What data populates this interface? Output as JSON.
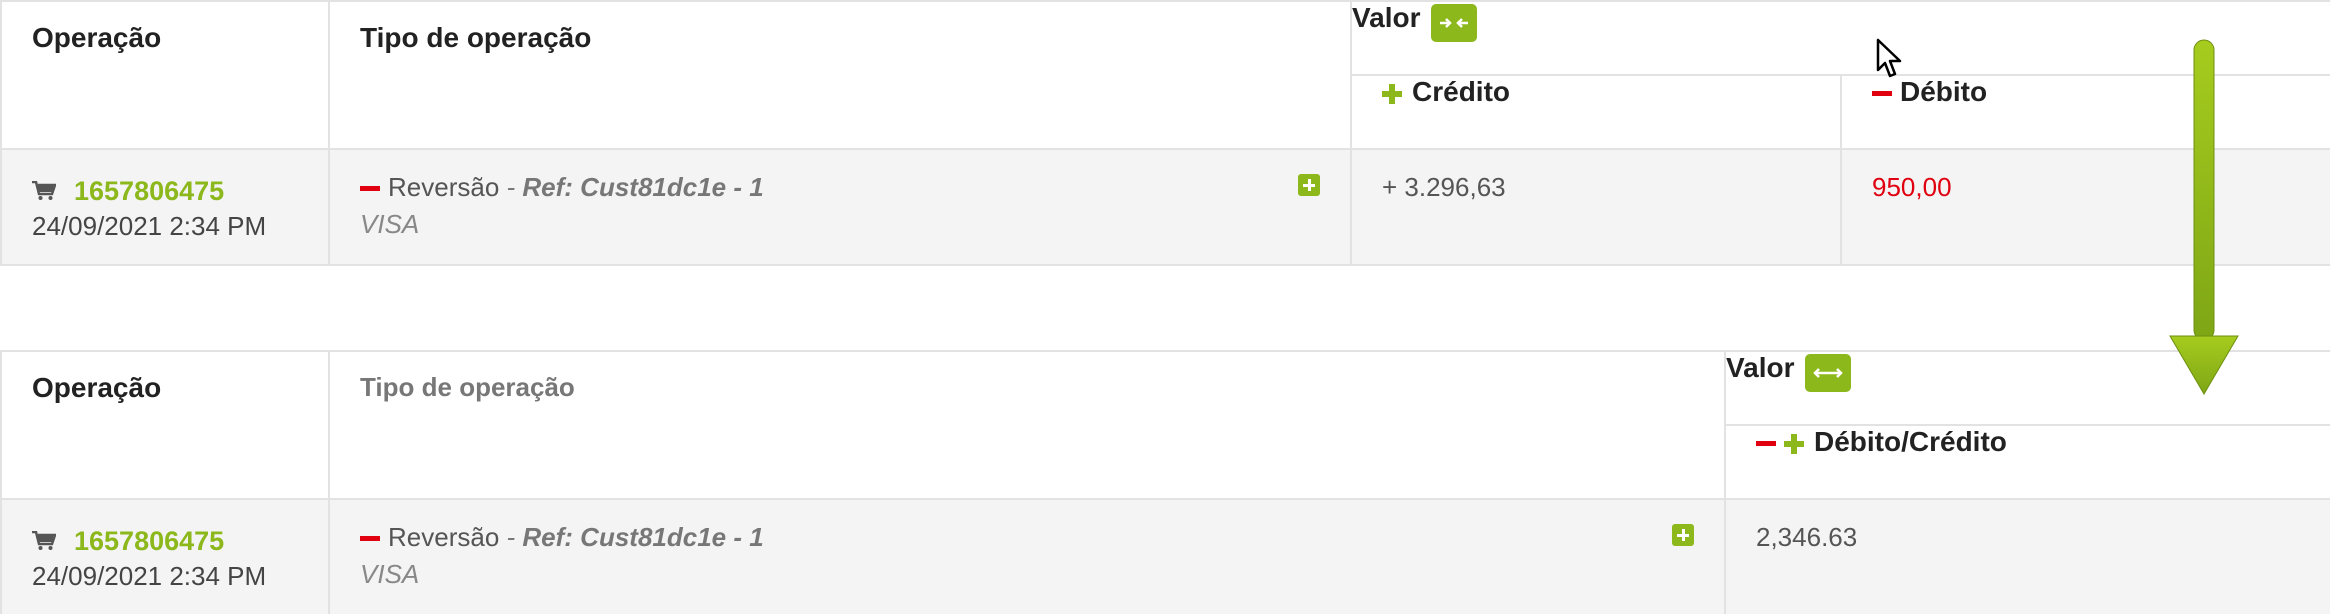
{
  "colors": {
    "accent_green": "#8cb81c",
    "debit_red": "#e0000f",
    "border": "#e2e2e2",
    "row_bg": "#f4f4f4"
  },
  "table_expanded": {
    "headers": {
      "operacao": "Operação",
      "tipo": "Tipo de operação",
      "valor": "Valor",
      "credito": "Crédito",
      "debito": "Débito"
    },
    "toggle_icon": "collapse-arrows-icon",
    "row": {
      "op_id": "1657806475",
      "date": "24/09/2021 2:34 PM",
      "tipo_name": "Reversão",
      "ref_sep": " - ",
      "ref": "Ref: Cust81dc1e - 1",
      "brand": "VISA",
      "credit": "+ 3.296,63",
      "debit": "950,00"
    }
  },
  "table_collapsed": {
    "headers": {
      "operacao": "Operação",
      "tipo": "Tipo de operação",
      "valor": "Valor",
      "debito_credito": "Débito/Crédito"
    },
    "toggle_icon": "expand-arrows-icon",
    "row": {
      "op_id": "1657806475",
      "date": "24/09/2021 2:34 PM",
      "tipo_name": "Reversão",
      "ref_sep": " - ",
      "ref": "Ref: Cust81dc1e - 1",
      "brand": "VISA",
      "amount": "2,346.63"
    }
  }
}
